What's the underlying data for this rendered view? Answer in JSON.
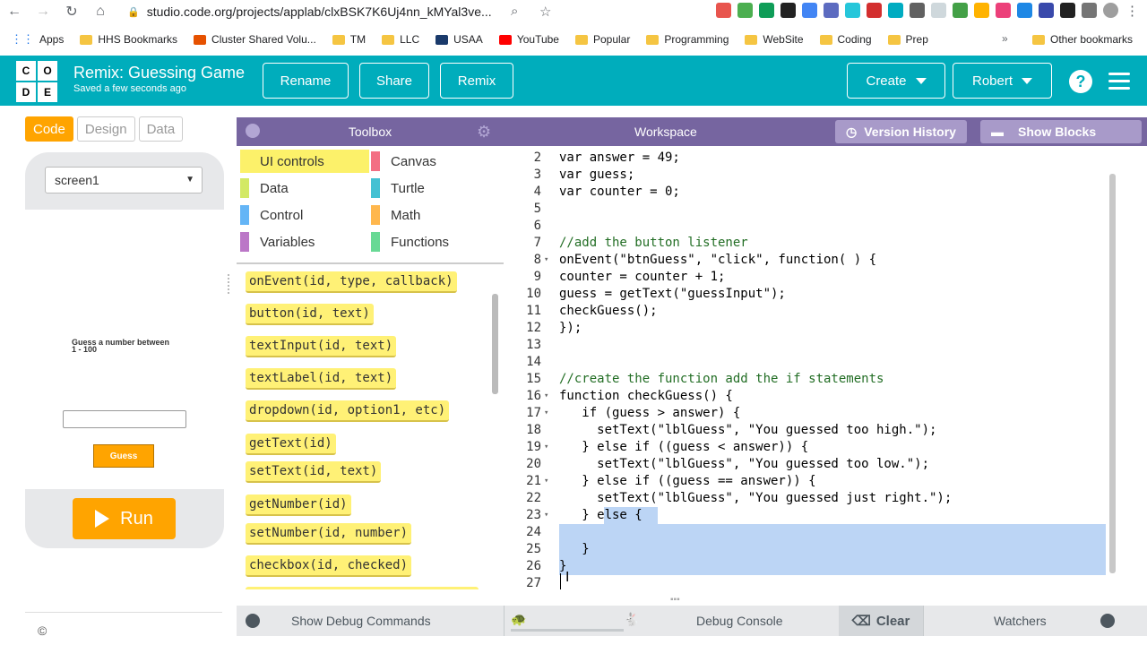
{
  "browser": {
    "url": "studio.code.org/projects/applab/clxBSK7K6Uj4nn_kMYal3ve...",
    "bookmarks": [
      "Apps",
      "HHS Bookmarks",
      "Cluster Shared Volu...",
      "TM",
      "LLC",
      "USAA",
      "YouTube",
      "Popular",
      "Programming",
      "WebSite",
      "Coding",
      "Prep"
    ],
    "other_bookmarks": "Other bookmarks",
    "more": "»"
  },
  "header": {
    "logo_letters": [
      "C",
      "O",
      "D",
      "E"
    ],
    "project_title": "Remix: Guessing Game",
    "saved_status": "Saved a few seconds ago",
    "rename": "Rename",
    "share": "Share",
    "remix": "Remix",
    "create": "Create",
    "user": "Robert",
    "help": "?"
  },
  "left_panel": {
    "tabs": [
      "Code",
      "Design",
      "Data"
    ],
    "screen_select": "screen1",
    "app_label": "Guess a number between 1 - 100",
    "app_button": "Guess",
    "run": "Run",
    "copyright": "©"
  },
  "toolbox": {
    "title": "Toolbox",
    "categories": [
      {
        "label": "UI controls",
        "color": "#fcf16a"
      },
      {
        "label": "Canvas",
        "color": "#f36f84"
      },
      {
        "label": "Data",
        "color": "#d3e965"
      },
      {
        "label": "Turtle",
        "color": "#44c1d3"
      },
      {
        "label": "Control",
        "color": "#64b5f6"
      },
      {
        "label": "Math",
        "color": "#ffb74d"
      },
      {
        "label": "Variables",
        "color": "#bb77c7"
      },
      {
        "label": "Functions",
        "color": "#68d995"
      }
    ],
    "blocks": [
      "onEvent(id, type, callback)",
      "button(id, text)",
      "textInput(id, text)",
      "textLabel(id, text)",
      "dropdown(id, option1, etc)",
      "getText(id)",
      "setText(id, text)",
      "getNumber(id)",
      "setNumber(id, number)",
      "checkbox(id, checked)"
    ]
  },
  "workspace": {
    "title": "Workspace",
    "version_history": "Version History",
    "show_blocks": "Show Blocks",
    "lines": [
      {
        "n": "2",
        "fold": "",
        "text": "var answer = 49;"
      },
      {
        "n": "3",
        "fold": "",
        "text": "var guess;"
      },
      {
        "n": "4",
        "fold": "",
        "text": "var counter = 0;"
      },
      {
        "n": "5",
        "fold": "",
        "text": ""
      },
      {
        "n": "6",
        "fold": "",
        "text": ""
      },
      {
        "n": "7",
        "fold": "",
        "text": "//add the button listener"
      },
      {
        "n": "8",
        "fold": "▾",
        "text": "onEvent(\"btnGuess\", \"click\", function( ) {"
      },
      {
        "n": "9",
        "fold": "",
        "text": "counter = counter + 1;"
      },
      {
        "n": "10",
        "fold": "",
        "text": "guess = getText(\"guessInput\");"
      },
      {
        "n": "11",
        "fold": "",
        "text": "checkGuess();"
      },
      {
        "n": "12",
        "fold": "",
        "text": "});"
      },
      {
        "n": "13",
        "fold": "",
        "text": ""
      },
      {
        "n": "14",
        "fold": "",
        "text": ""
      },
      {
        "n": "15",
        "fold": "",
        "text": "//create the function add the if statements"
      },
      {
        "n": "16",
        "fold": "▾",
        "text": "function checkGuess() {"
      },
      {
        "n": "17",
        "fold": "▾",
        "text": "   if (guess > answer) {"
      },
      {
        "n": "18",
        "fold": "",
        "text": "     setText(\"lblGuess\", \"You guessed too high.\");"
      },
      {
        "n": "19",
        "fold": "▾",
        "text": "   } else if ((guess < answer)) {"
      },
      {
        "n": "20",
        "fold": "",
        "text": "     setText(\"lblGuess\", \"You guessed too low.\");"
      },
      {
        "n": "21",
        "fold": "▾",
        "text": "   } else if ((guess == answer)) {"
      },
      {
        "n": "22",
        "fold": "",
        "text": "     setText(\"lblGuess\", \"You guessed just right.\");"
      },
      {
        "n": "23",
        "fold": "▾",
        "text": "   } else {"
      },
      {
        "n": "24",
        "fold": "",
        "text": ""
      },
      {
        "n": "25",
        "fold": "",
        "text": "   }"
      },
      {
        "n": "26",
        "fold": "",
        "text": "}"
      },
      {
        "n": "27",
        "fold": "",
        "text": ""
      }
    ]
  },
  "debug": {
    "show_debug_commands": "Show Debug Commands",
    "debug_console": "Debug Console",
    "clear": "Clear",
    "watchers": "Watchers"
  },
  "colors": {
    "brand": "#00adbc",
    "accent": "#ffa400",
    "toolbox_header": "#7665a0",
    "selection": "#bcd5f5"
  }
}
